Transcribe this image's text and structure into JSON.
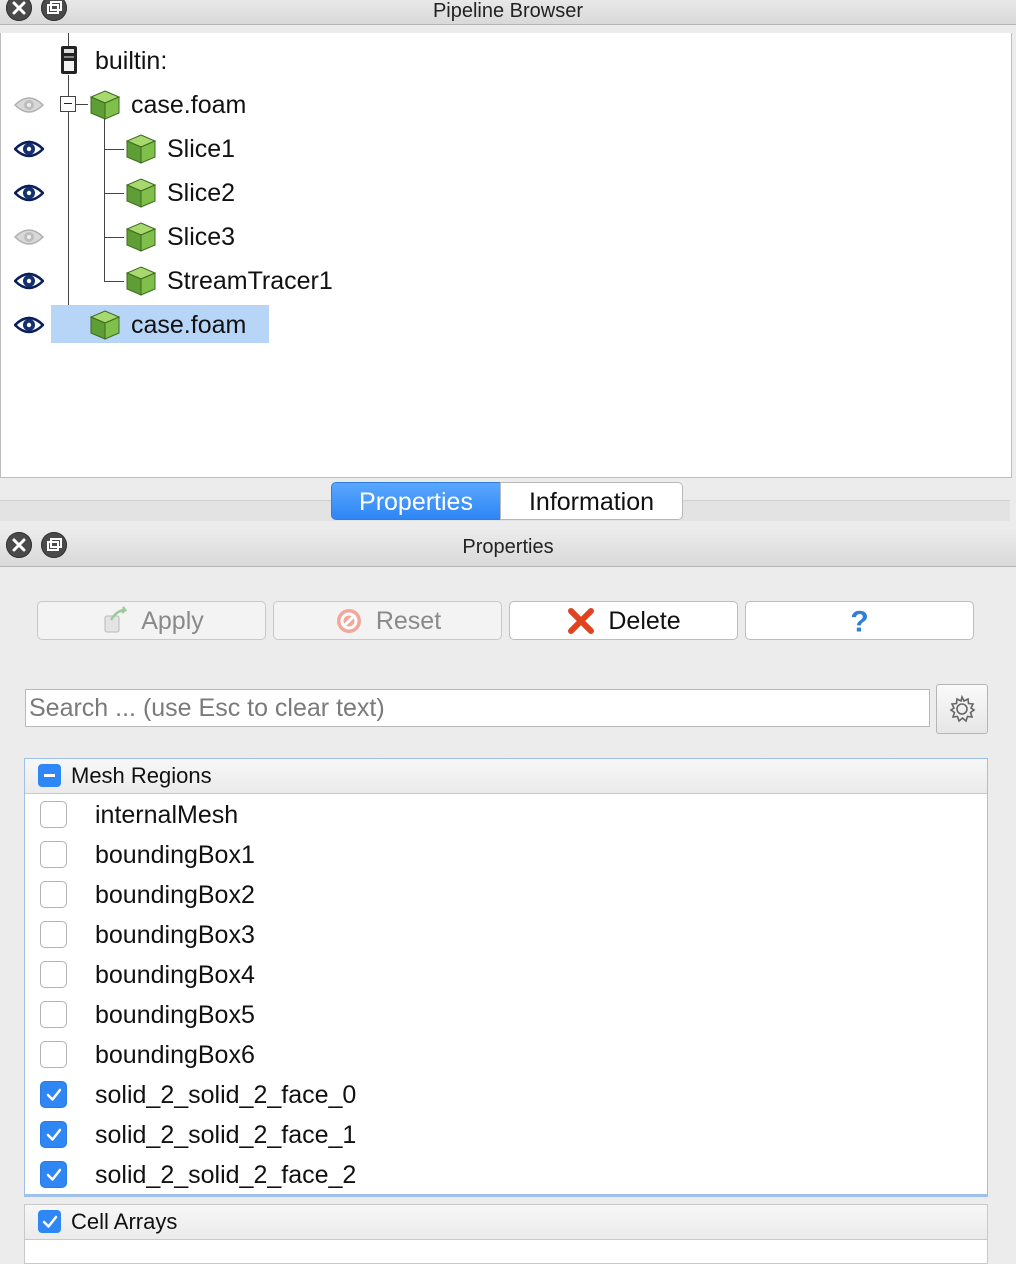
{
  "pipeline_dock": {
    "title": "Pipeline Browser",
    "items": [
      {
        "label": "builtin:",
        "eye": "none",
        "icon": "server-icon"
      },
      {
        "label": "case.foam",
        "eye": "hidden",
        "icon": "cube-icon"
      },
      {
        "label": "Slice1",
        "eye": "visible",
        "icon": "cube-icon"
      },
      {
        "label": "Slice2",
        "eye": "visible",
        "icon": "cube-icon"
      },
      {
        "label": "Slice3",
        "eye": "hidden",
        "icon": "cube-icon"
      },
      {
        "label": "StreamTracer1",
        "eye": "visible",
        "icon": "cube-icon"
      },
      {
        "label": "case.foam",
        "eye": "visible",
        "icon": "cube-icon",
        "selected": true
      }
    ]
  },
  "tabs": [
    {
      "label": "Properties",
      "active": true
    },
    {
      "label": "Information",
      "active": false
    }
  ],
  "properties_dock": {
    "title": "Properties",
    "buttons": {
      "apply": "Apply",
      "reset": "Reset",
      "delete": "Delete",
      "help": "?"
    },
    "search": {
      "placeholder": "Search ... (use Esc to clear text)",
      "value": ""
    }
  },
  "mesh_regions": {
    "title": "Mesh Regions",
    "items": [
      {
        "label": "internalMesh",
        "checked": false
      },
      {
        "label": "boundingBox1",
        "checked": false
      },
      {
        "label": "boundingBox2",
        "checked": false
      },
      {
        "label": "boundingBox3",
        "checked": false
      },
      {
        "label": "boundingBox4",
        "checked": false
      },
      {
        "label": "boundingBox5",
        "checked": false
      },
      {
        "label": "boundingBox6",
        "checked": false
      },
      {
        "label": "solid_2_solid_2_face_0",
        "checked": true
      },
      {
        "label": "solid_2_solid_2_face_1",
        "checked": true
      },
      {
        "label": "solid_2_solid_2_face_2",
        "checked": true
      }
    ]
  },
  "cell_arrays": {
    "title": "Cell Arrays",
    "checked": true
  },
  "colors": {
    "accent": "#2f86f5",
    "selection": "#b7d5f7",
    "cube_green": "#7fbf4a"
  }
}
